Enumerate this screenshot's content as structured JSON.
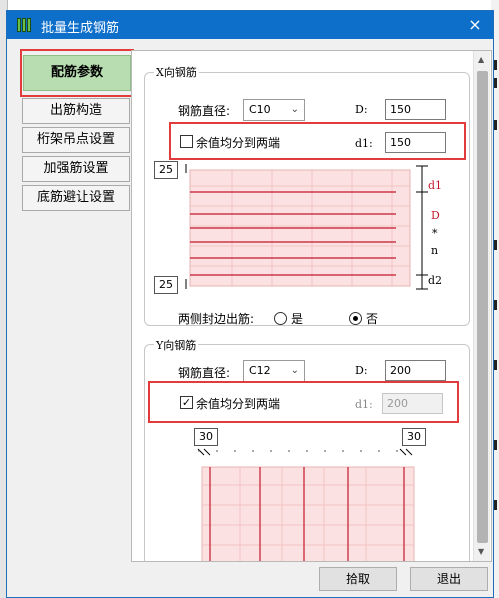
{
  "window": {
    "title": "批量生成钢筋",
    "close_glyph": "×"
  },
  "tabs": [
    {
      "label": "配筋参数"
    },
    {
      "label": "出筋构造"
    },
    {
      "label": "桁架吊点设置"
    },
    {
      "label": "加强筋设置"
    },
    {
      "label": "底筋避让设置"
    }
  ],
  "x_group": {
    "title": "X向钢筋",
    "diameter_label": "钢筋直径:",
    "diameter_value": "C10",
    "spacing_label": "D:",
    "spacing_value": "150",
    "split_label": "余值均分到两端",
    "split_checked": false,
    "d1_label": "d1:",
    "d1_value": "150",
    "top_value": "25",
    "bottom_value": "25",
    "dim_d1": "d1",
    "dim_dn": "D",
    "dim_star": "*",
    "dim_n": "n",
    "dim_d2": "d2",
    "both_side_label": "两侧封边出筋:",
    "yes_label": "是",
    "no_label": "否",
    "both_side_selected": "否"
  },
  "y_group": {
    "title": "Y向钢筋",
    "diameter_label": "钢筋直径:",
    "diameter_value": "C12",
    "spacing_label": "D:",
    "spacing_value": "200",
    "split_label": "余值均分到两端",
    "split_checked": true,
    "d1_label": "d1:",
    "d1_value": "200",
    "left_value": "30",
    "right_value": "30"
  },
  "footer": {
    "cancel_label": "拾取",
    "exit_label": "退出"
  },
  "colors": {
    "titlebar": "#0e6fcb",
    "active_tab": "#b8ddb1",
    "highlight_box": "#e23b3b",
    "diagram_fill": "#fbe1e1",
    "rebar_line": "#c4172c"
  }
}
